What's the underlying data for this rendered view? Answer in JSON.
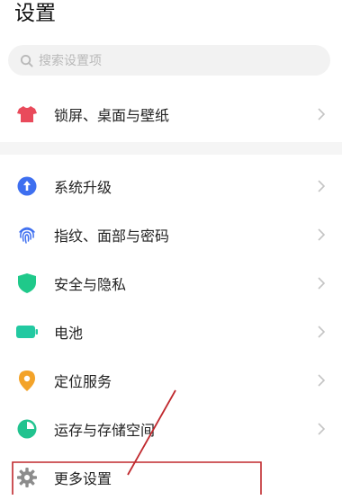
{
  "header": {
    "title": "设置"
  },
  "search": {
    "placeholder": "搜索设置项"
  },
  "items": [
    {
      "label": "锁屏、桌面与壁纸",
      "icon": "tshirt-icon",
      "color": "#e94a5b"
    },
    {
      "label": "系统升级",
      "icon": "upgrade-arrow-icon",
      "color": "#3e6ff0"
    },
    {
      "label": "指纹、面部与密码",
      "icon": "fingerprint-icon",
      "color": "#3e6ff0"
    },
    {
      "label": "安全与隐私",
      "icon": "shield-icon",
      "color": "#1fc98a"
    },
    {
      "label": "电池",
      "icon": "battery-icon",
      "color": "#22c9a1"
    },
    {
      "label": "定位服务",
      "icon": "location-pin-icon",
      "color": "#f3a329"
    },
    {
      "label": "运存与存储空间",
      "icon": "pie-chart-icon",
      "color": "#21c38f"
    },
    {
      "label": "更多设置",
      "icon": "gear-icon",
      "color": "#8c8c8c"
    }
  ],
  "annotation_color": "#c0282d"
}
